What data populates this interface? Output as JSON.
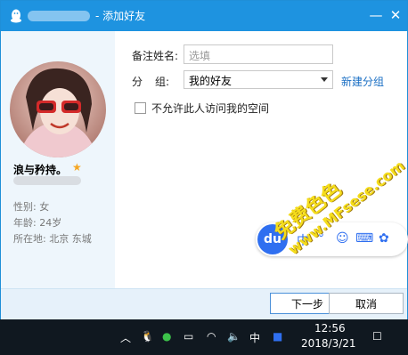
{
  "titlebar": {
    "title_suffix": "- 添加好友",
    "minimize_symbol": "—",
    "close_symbol": "✕"
  },
  "profile": {
    "nickname": "浪与矜持。",
    "gender": "性别: 女",
    "age": "年龄: 24岁",
    "location": "所在地: 北京  东城"
  },
  "form": {
    "remark_label": "备注姓名:",
    "remark_placeholder": "选填",
    "group_label_1": "分",
    "group_label_2": "组:",
    "group_value": "我的好友",
    "new_group_link": "新建分组",
    "privacy_label": "不允许此人访问我的空间"
  },
  "ime": {
    "logo": "du",
    "mode": "中",
    "dot": "°",
    "smile": "☺",
    "keyboard": "⌨",
    "settings": "✿"
  },
  "buttons": {
    "next": "下一步",
    "cancel": "取消"
  },
  "watermark": {
    "line1": "免费色色",
    "line2": "www.MFsese.com"
  },
  "taskbar": {
    "ime_indicator": "中",
    "time": "12:56",
    "date": "2018/3/21"
  },
  "colors": {
    "titlebar": "#1e93e0",
    "link": "#1a6fc4",
    "ime_blue": "#2f6ff0"
  }
}
